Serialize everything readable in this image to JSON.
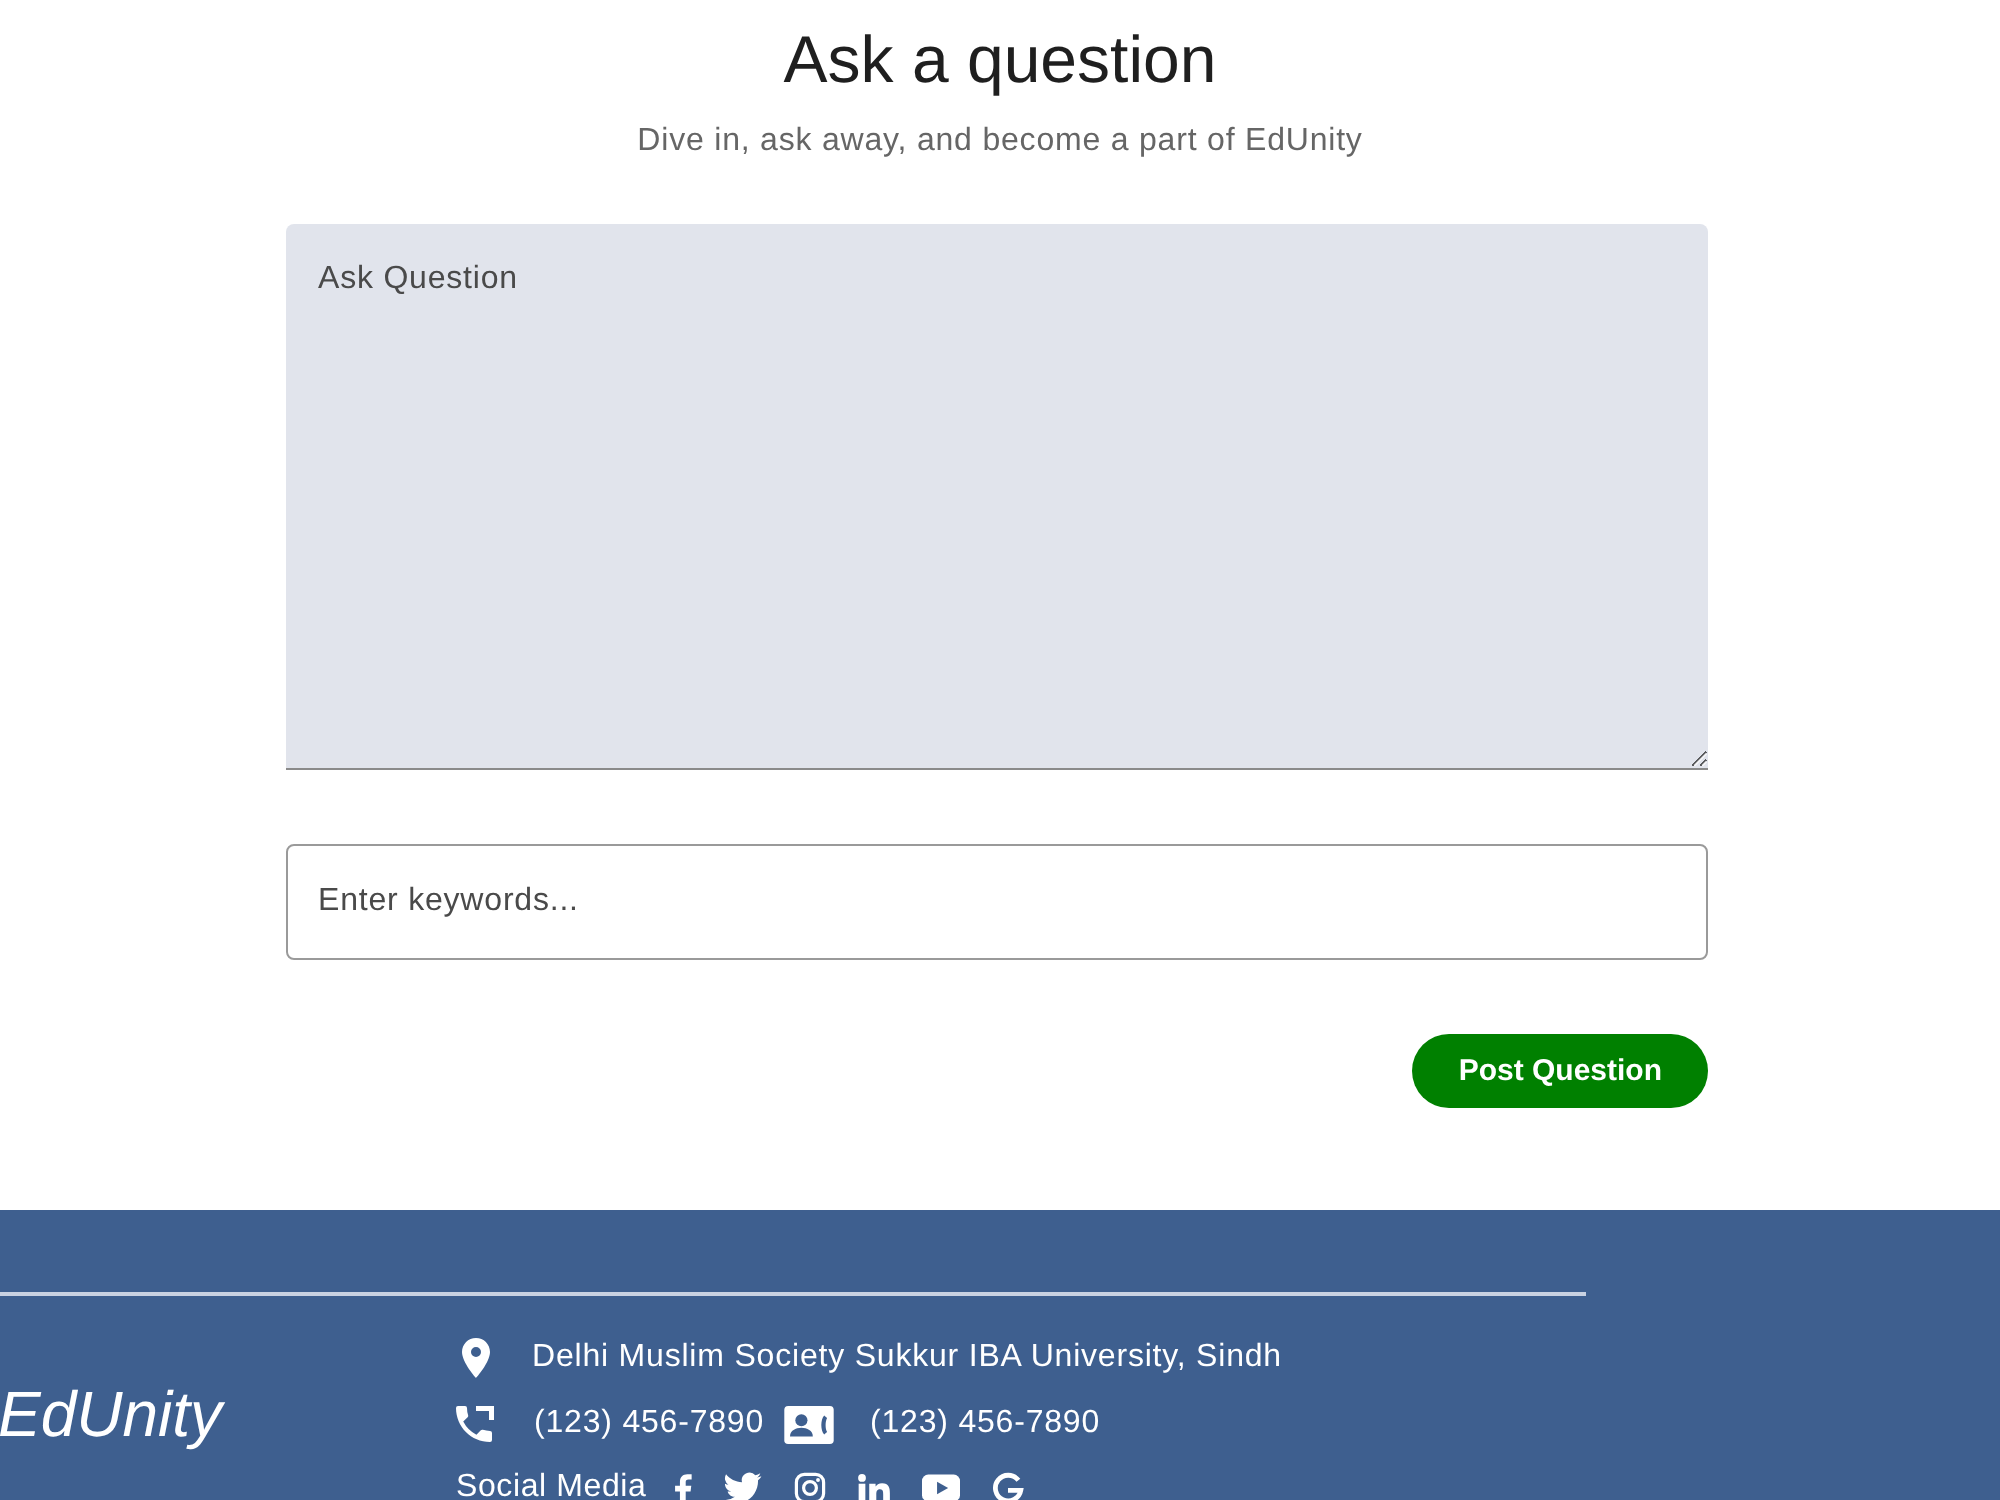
{
  "heading": {
    "title": "Ask a question",
    "subtitle": "Dive in, ask away, and become a part of EdUnity"
  },
  "question_form": {
    "question_field": {
      "placeholder": "Ask Question"
    },
    "keywords_field": {
      "placeholder": "Enter keywords..."
    },
    "submit_button": {
      "label": "Post Question"
    }
  },
  "footer": {
    "brand": "EdUnity",
    "contact_lines": [
      {
        "items": [
          {
            "kind": "location",
            "text": "Delhi Muslim Society Sukkur IBA University, Sindh"
          }
        ]
      },
      {
        "items": [
          {
            "kind": "phone",
            "text": "(123) 456-7890"
          },
          {
            "kind": "contact_card",
            "text": "(123) 456-7890"
          }
        ]
      }
    ],
    "social": {
      "label": "Social Media",
      "links": [
        {
          "kind": "facebook"
        },
        {
          "kind": "twitter"
        },
        {
          "kind": "instagram"
        },
        {
          "kind": "linkedin"
        },
        {
          "kind": "youtube"
        },
        {
          "kind": "google"
        }
      ]
    }
  }
}
